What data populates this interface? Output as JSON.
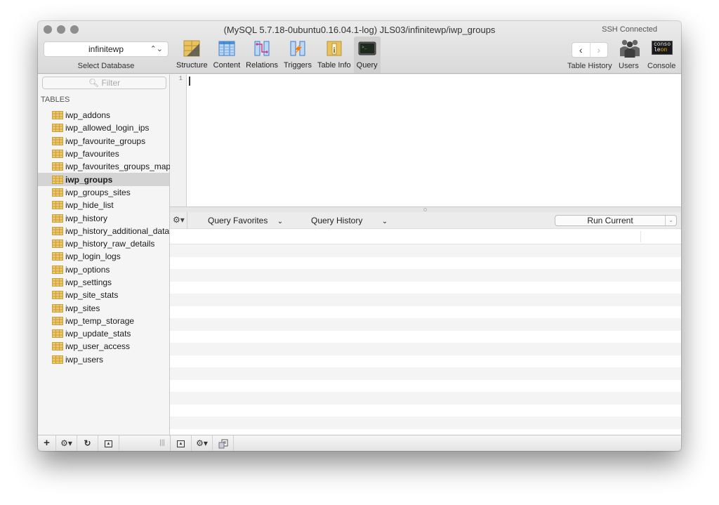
{
  "window": {
    "title": "(MySQL 5.7.18-0ubuntu0.16.04.1-log) JLS03/infinitewp/iwp_groups",
    "connection_status": "SSH Connected"
  },
  "database_selector": {
    "value": "infinitewp",
    "label": "Select Database"
  },
  "toolbar": {
    "tabs": [
      {
        "label": "Structure",
        "icon": "structure-icon",
        "active": false
      },
      {
        "label": "Content",
        "icon": "content-icon",
        "active": false
      },
      {
        "label": "Relations",
        "icon": "relations-icon",
        "active": false
      },
      {
        "label": "Triggers",
        "icon": "triggers-icon",
        "active": false
      },
      {
        "label": "Table Info",
        "icon": "table-info-icon",
        "active": false
      },
      {
        "label": "Query",
        "icon": "query-terminal-icon",
        "active": true
      }
    ],
    "table_history_label": "Table History",
    "back_glyph": "‹",
    "forward_glyph": "›",
    "users_label": "Users",
    "console_label": "Console",
    "console_icon_text_top": "conso",
    "console_icon_text_bottom_a": "le",
    "console_icon_text_bottom_b": "on"
  },
  "sidebar": {
    "filter_placeholder": "Filter",
    "section_title": "TABLES",
    "selected_table": "iwp_groups",
    "tables": [
      "iwp_addons",
      "iwp_allowed_login_ips",
      "iwp_favourite_groups",
      "iwp_favourites",
      "iwp_favourites_groups_map",
      "iwp_groups",
      "iwp_groups_sites",
      "iwp_hide_list",
      "iwp_history",
      "iwp_history_additional_data",
      "iwp_history_raw_details",
      "iwp_login_logs",
      "iwp_options",
      "iwp_settings",
      "iwp_site_stats",
      "iwp_sites",
      "iwp_temp_storage",
      "iwp_update_stats",
      "iwp_user_access",
      "iwp_users"
    ]
  },
  "editor": {
    "line_numbers": [
      "1"
    ],
    "content": ""
  },
  "query_bar": {
    "gear_glyph": "⚙▾",
    "favorites_label": "Query Favorites",
    "history_label": "Query History",
    "chevron_glyph": "⌄",
    "run_button_label": "Run Current"
  },
  "bottom_bar": {
    "add_glyph": "+",
    "gear_glyph": "⚙▾",
    "refresh_glyph": "↻",
    "resize_glyph": "|||"
  },
  "colors": {
    "selected_row": "#d4d4d4",
    "table_icon": "#e8c25a",
    "content_icon": "#4a90d9",
    "relations_link": "#d0368a",
    "triggers_bolt": "#ff7a00"
  }
}
